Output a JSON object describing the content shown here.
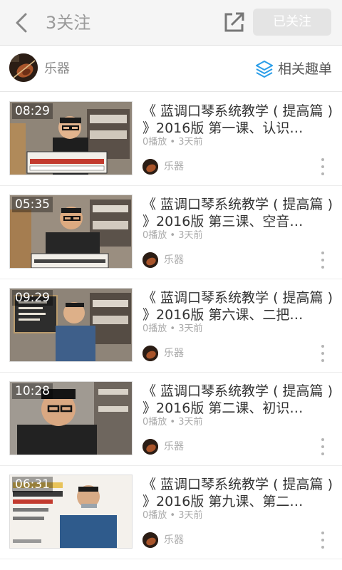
{
  "header": {
    "title": "3关注",
    "follow_label": "已关注"
  },
  "channel": {
    "name": "乐器",
    "related_label": "相关趣单"
  },
  "videos": [
    {
      "duration": "08:29",
      "title": "《 蓝调口琴系统教学 ( 提高篇 ) 》2016版 第一课、认识…",
      "meta": "0播放 • 3天前",
      "uploader": "乐器"
    },
    {
      "duration": "05:35",
      "title": "《 蓝调口琴系统教学 ( 提高篇 ) 》2016版 第三课、空音…",
      "meta": "0播放 • 3天前",
      "uploader": "乐器"
    },
    {
      "duration": "09:29",
      "title": "《 蓝调口琴系统教学 ( 提高篇 ) 》2016版 第六课、二把…",
      "meta": "0播放 • 3天前",
      "uploader": "乐器"
    },
    {
      "duration": "10:28",
      "title": "《 蓝调口琴系统教学 ( 提高篇 ) 》2016版 第二课、初识…",
      "meta": "0播放 • 3天前",
      "uploader": "乐器"
    },
    {
      "duration": "06:31",
      "title": "《 蓝调口琴系统教学 ( 提高篇 ) 》2016版 第九课、第二…",
      "meta": "0播放 • 3天前",
      "uploader": "乐器"
    }
  ],
  "icons": {
    "back": "chevron-left-icon",
    "share": "share-out-icon",
    "related": "layers-icon",
    "more": "more-vertical-icon"
  },
  "colors": {
    "related_icon": "#2a9de8",
    "follow_button_bg": "#e4e4e4"
  }
}
